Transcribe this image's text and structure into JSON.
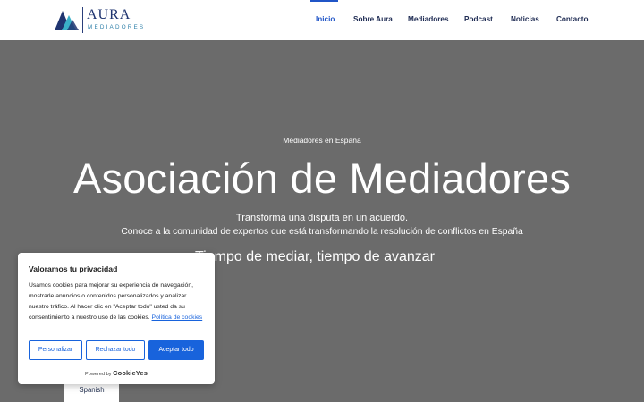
{
  "header": {
    "logo": {
      "name": "AURA",
      "subtitle": "MEDIADORES",
      "colors": {
        "navy": "#1f3470",
        "teal": "#3ab0c8"
      }
    },
    "nav": [
      {
        "label": "Inicio",
        "active": true
      },
      {
        "label": "Sobre Aura",
        "active": false
      },
      {
        "label": "Mediadores",
        "active": false
      },
      {
        "label": "Podcast",
        "active": false
      },
      {
        "label": "Noticias",
        "active": false
      },
      {
        "label": "Contacto",
        "active": false
      }
    ],
    "accent": "#2055c7"
  },
  "hero": {
    "eyebrow": "Mediadores en España",
    "title": "Asociación de Mediadores",
    "line1": "Transforma una disputa en un acuerdo.",
    "line2": "Conoce a la comunidad de expertos que está transformando la resolución de conflictos en España",
    "tagline": "Tiempo de mediar, tiempo de avanzar",
    "background": "#6b6b6b"
  },
  "language": {
    "label": "Spanish"
  },
  "cookie_banner": {
    "title": "Valoramos tu privacidad",
    "text": "Usamos cookies para mejorar su experiencia de navegación, mostrarle anuncios o contenidos personalizados y analizar nuestro tráfico. Al hacer clic en \"Aceptar todo\" usted da su consentimiento a nuestro uso de las cookies.",
    "policy_link": "Política de cookies",
    "buttons": {
      "customize": "Personalizar",
      "reject": "Rechazar todo",
      "accept": "Aceptar todo"
    },
    "powered_by": "Powered by",
    "brand": "CookieYes",
    "accent": "#1863dc"
  }
}
